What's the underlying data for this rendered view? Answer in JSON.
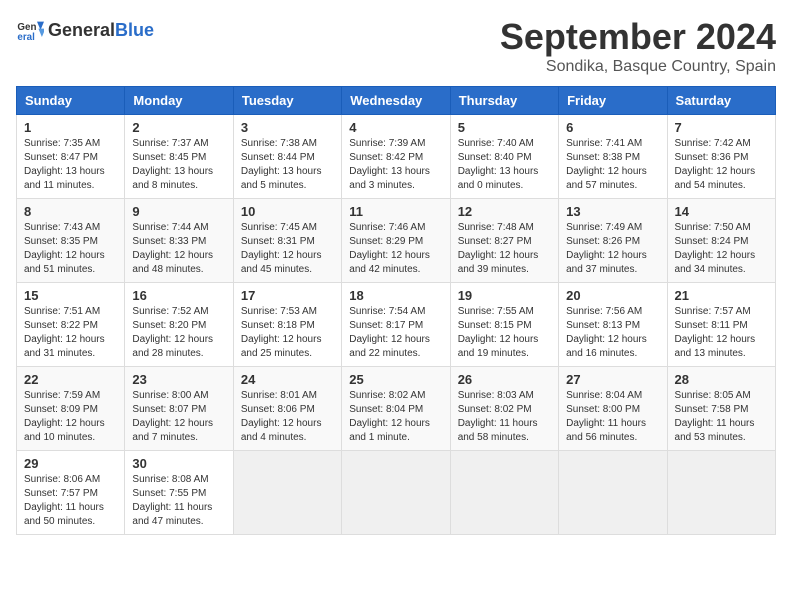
{
  "header": {
    "logo_general": "General",
    "logo_blue": "Blue",
    "month_title": "September 2024",
    "location": "Sondika, Basque Country, Spain"
  },
  "weekdays": [
    "Sunday",
    "Monday",
    "Tuesday",
    "Wednesday",
    "Thursday",
    "Friday",
    "Saturday"
  ],
  "weeks": [
    [
      {
        "num": "1",
        "sunrise": "7:35 AM",
        "sunset": "8:47 PM",
        "daylight": "13 hours and 11 minutes."
      },
      {
        "num": "2",
        "sunrise": "7:37 AM",
        "sunset": "8:45 PM",
        "daylight": "13 hours and 8 minutes."
      },
      {
        "num": "3",
        "sunrise": "7:38 AM",
        "sunset": "8:44 PM",
        "daylight": "13 hours and 5 minutes."
      },
      {
        "num": "4",
        "sunrise": "7:39 AM",
        "sunset": "8:42 PM",
        "daylight": "13 hours and 3 minutes."
      },
      {
        "num": "5",
        "sunrise": "7:40 AM",
        "sunset": "8:40 PM",
        "daylight": "13 hours and 0 minutes."
      },
      {
        "num": "6",
        "sunrise": "7:41 AM",
        "sunset": "8:38 PM",
        "daylight": "12 hours and 57 minutes."
      },
      {
        "num": "7",
        "sunrise": "7:42 AM",
        "sunset": "8:36 PM",
        "daylight": "12 hours and 54 minutes."
      }
    ],
    [
      {
        "num": "8",
        "sunrise": "7:43 AM",
        "sunset": "8:35 PM",
        "daylight": "12 hours and 51 minutes."
      },
      {
        "num": "9",
        "sunrise": "7:44 AM",
        "sunset": "8:33 PM",
        "daylight": "12 hours and 48 minutes."
      },
      {
        "num": "10",
        "sunrise": "7:45 AM",
        "sunset": "8:31 PM",
        "daylight": "12 hours and 45 minutes."
      },
      {
        "num": "11",
        "sunrise": "7:46 AM",
        "sunset": "8:29 PM",
        "daylight": "12 hours and 42 minutes."
      },
      {
        "num": "12",
        "sunrise": "7:48 AM",
        "sunset": "8:27 PM",
        "daylight": "12 hours and 39 minutes."
      },
      {
        "num": "13",
        "sunrise": "7:49 AM",
        "sunset": "8:26 PM",
        "daylight": "12 hours and 37 minutes."
      },
      {
        "num": "14",
        "sunrise": "7:50 AM",
        "sunset": "8:24 PM",
        "daylight": "12 hours and 34 minutes."
      }
    ],
    [
      {
        "num": "15",
        "sunrise": "7:51 AM",
        "sunset": "8:22 PM",
        "daylight": "12 hours and 31 minutes."
      },
      {
        "num": "16",
        "sunrise": "7:52 AM",
        "sunset": "8:20 PM",
        "daylight": "12 hours and 28 minutes."
      },
      {
        "num": "17",
        "sunrise": "7:53 AM",
        "sunset": "8:18 PM",
        "daylight": "12 hours and 25 minutes."
      },
      {
        "num": "18",
        "sunrise": "7:54 AM",
        "sunset": "8:17 PM",
        "daylight": "12 hours and 22 minutes."
      },
      {
        "num": "19",
        "sunrise": "7:55 AM",
        "sunset": "8:15 PM",
        "daylight": "12 hours and 19 minutes."
      },
      {
        "num": "20",
        "sunrise": "7:56 AM",
        "sunset": "8:13 PM",
        "daylight": "12 hours and 16 minutes."
      },
      {
        "num": "21",
        "sunrise": "7:57 AM",
        "sunset": "8:11 PM",
        "daylight": "12 hours and 13 minutes."
      }
    ],
    [
      {
        "num": "22",
        "sunrise": "7:59 AM",
        "sunset": "8:09 PM",
        "daylight": "12 hours and 10 minutes."
      },
      {
        "num": "23",
        "sunrise": "8:00 AM",
        "sunset": "8:07 PM",
        "daylight": "12 hours and 7 minutes."
      },
      {
        "num": "24",
        "sunrise": "8:01 AM",
        "sunset": "8:06 PM",
        "daylight": "12 hours and 4 minutes."
      },
      {
        "num": "25",
        "sunrise": "8:02 AM",
        "sunset": "8:04 PM",
        "daylight": "12 hours and 1 minute."
      },
      {
        "num": "26",
        "sunrise": "8:03 AM",
        "sunset": "8:02 PM",
        "daylight": "11 hours and 58 minutes."
      },
      {
        "num": "27",
        "sunrise": "8:04 AM",
        "sunset": "8:00 PM",
        "daylight": "11 hours and 56 minutes."
      },
      {
        "num": "28",
        "sunrise": "8:05 AM",
        "sunset": "7:58 PM",
        "daylight": "11 hours and 53 minutes."
      }
    ],
    [
      {
        "num": "29",
        "sunrise": "8:06 AM",
        "sunset": "7:57 PM",
        "daylight": "11 hours and 50 minutes."
      },
      {
        "num": "30",
        "sunrise": "8:08 AM",
        "sunset": "7:55 PM",
        "daylight": "11 hours and 47 minutes."
      },
      null,
      null,
      null,
      null,
      null
    ]
  ]
}
